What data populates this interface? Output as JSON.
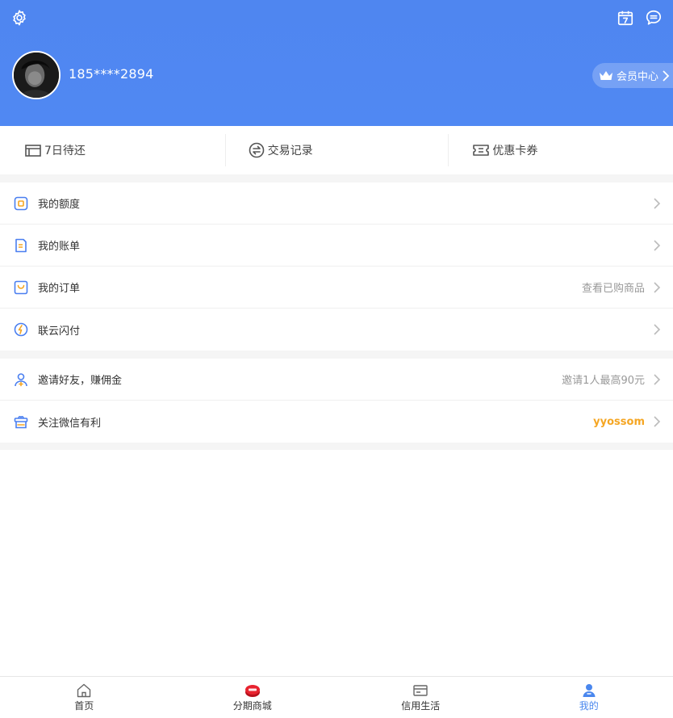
{
  "header": {
    "phone": "185****2894",
    "vip_label": "会员中心"
  },
  "quick": [
    {
      "label": "7日待还",
      "icon": "wallet-icon"
    },
    {
      "label": "交易记录",
      "icon": "exchange-icon"
    },
    {
      "label": "优惠卡券",
      "icon": "ticket-icon"
    }
  ],
  "menu1": [
    {
      "label": "我的额度",
      "extra": "",
      "icon": "quota-icon"
    },
    {
      "label": "我的账单",
      "extra": "",
      "icon": "bill-icon"
    },
    {
      "label": "我的订单",
      "extra": "查看已购商品",
      "icon": "order-icon"
    },
    {
      "label": "联云闪付",
      "extra": "",
      "icon": "flash-pay-icon"
    }
  ],
  "menu2": [
    {
      "label": "邀请好友，赚佣金",
      "extra": "邀请1人最高90元",
      "icon": "invite-icon"
    },
    {
      "label": "关注微信有利",
      "extra": "yyossom",
      "icon": "gift-icon"
    }
  ],
  "tabbar": [
    {
      "label": "首页",
      "icon": "home-icon",
      "active": false
    },
    {
      "label": "分期商城",
      "icon": "mall-icon",
      "active": false
    },
    {
      "label": "信用生活",
      "icon": "card-icon",
      "active": false
    },
    {
      "label": "我的",
      "icon": "user-icon",
      "active": true
    }
  ],
  "colors": {
    "primary": "#4f86f0",
    "accent_orange": "#f5a623",
    "icon_blue": "#4a7ff0",
    "icon_orange": "#f5a623"
  }
}
